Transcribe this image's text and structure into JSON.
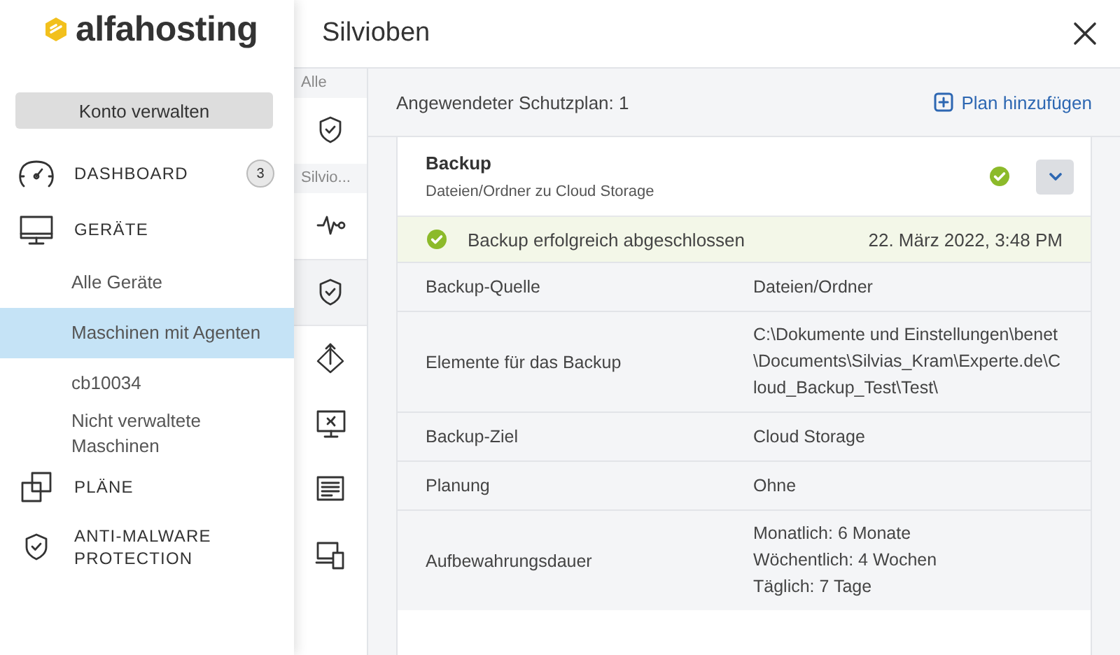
{
  "logo": {
    "text": "alfahosting"
  },
  "sidebar": {
    "account_button": "Konto verwalten",
    "items": [
      {
        "kind": "section",
        "label": "DASHBOARD",
        "badge": "3",
        "selected": false
      },
      {
        "kind": "section",
        "label": "GERÄTE",
        "selected": false
      },
      {
        "kind": "sub",
        "label": "Alle Geräte",
        "selected": false
      },
      {
        "kind": "sub",
        "label": "Maschinen mit Agenten",
        "selected": true
      },
      {
        "kind": "sub",
        "label": "cb10034",
        "selected": false
      },
      {
        "kind": "sub",
        "label": "Nicht verwaltete Maschinen",
        "selected": false
      },
      {
        "kind": "section",
        "label": "PLÄNE",
        "selected": false
      },
      {
        "kind": "section",
        "label": "ANTI-MALWARE PROTECTION",
        "selected": false
      }
    ]
  },
  "panel": {
    "title": "Silvioben",
    "rail": [
      {
        "label": "Alle",
        "items": [
          {
            "selected": false
          }
        ]
      },
      {
        "label": "Silvio...",
        "items": [
          {
            "selected": false
          },
          {
            "selected": true
          },
          {
            "selected": false
          },
          {
            "selected": false
          },
          {
            "selected": false
          },
          {
            "selected": false
          }
        ]
      }
    ],
    "summary": "Angewendeter Schutzplan: 1",
    "add_plan": "Plan hinzufügen",
    "plan": {
      "name": "Backup",
      "subtitle": "Dateien/Ordner zu Cloud Storage",
      "success": true,
      "last_result": {
        "success": true,
        "message": "Backup erfolgreich abgeschlossen",
        "time": "22. März 2022, 3:48 PM"
      },
      "details": [
        {
          "label": "Backup-Quelle",
          "value": [
            "Dateien/Ordner"
          ]
        },
        {
          "label": "Elemente für das Backup",
          "value": [
            "C:\\Dokumente und Einstellungen\\benet\\Documents\\Silvias_Kram\\Experte.de\\Cloud_Backup_Test\\Test\\"
          ]
        },
        {
          "label": "Backup-Ziel",
          "value": [
            "Cloud Storage"
          ]
        },
        {
          "label": "Planung",
          "value": [
            "Ohne"
          ]
        },
        {
          "label": "Aufbewahrungsdauer",
          "value": [
            "Monatlich: 6 Monate",
            "Wöchentlich: 4 Wochen",
            "Täglich: 7 Tage"
          ]
        }
      ]
    }
  }
}
